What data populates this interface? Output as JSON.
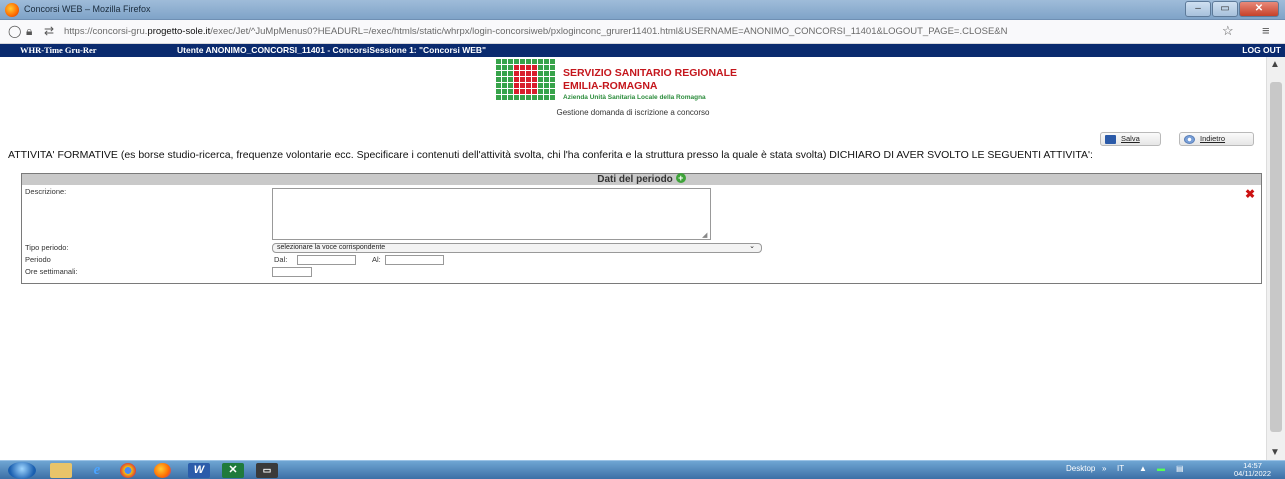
{
  "window": {
    "title": "Concorsi WEB – Mozilla Firefox",
    "buttons": {
      "minimize": "–",
      "maximize": "▭",
      "close": "✕"
    }
  },
  "browser": {
    "url_pre": "https://concorsi-gru.",
    "url_domain": "progetto-sole.it",
    "url_post": "/exec/Jet/^JuMpMenus0?HEADURL=/exec/htmls/static/whrpx/login-concorsiweb/pxloginconc_grurer11401.html&USERNAME=ANONIMO_CONCORSI_11401&LOGOUT_PAGE=.CLOSE&N",
    "bookmark_icon": "☆",
    "menu_icon": "≡"
  },
  "app_header": {
    "app_name": "WHR-Time Gru-Rer",
    "user_info": "Utente ANONIMO_CONCORSI_11401 - ConcorsiSessione 1: \"Concorsi WEB\"",
    "logout": "LOG OUT"
  },
  "logo": {
    "line1": "SERVIZIO SANITARIO REGIONALE",
    "line2": "EMILIA-ROMAGNA",
    "line3": "Azienda Unità Sanitaria Locale della Romagna"
  },
  "page": {
    "subtitle": "Gestione domanda di iscrizione a concorso",
    "save_label": "Salva",
    "back_label": "Indietro",
    "heading": "ATTIVITA' FORMATIVE (es borse studio-ricerca, frequenze volontarie ecc. Specificare i contenuti dell'attività svolta, chi l'ha conferita e la struttura presso la quale è stata svolta) DICHIARO DI AVER SVOLTO LE SEGUENTI ATTIVITA':"
  },
  "panel": {
    "title": "Dati del periodo",
    "add_icon": "+",
    "delete_icon": "✖",
    "fields": {
      "descrizione": "Descrizione:",
      "tipo_periodo": "Tipo periodo:",
      "periodo": "Periodo",
      "ore_settimanali": "Ore settimanali:",
      "dal": "Dal:",
      "al": "Al:"
    },
    "tipo_periodo_value": "selezionare la voce corrispondente",
    "descrizione_value": "",
    "dal_value": "",
    "al_value": "",
    "ore_value": ""
  },
  "taskbar": {
    "desktop": "Desktop",
    "language": "IT",
    "time": "14:57",
    "date": "04/11/2022"
  }
}
